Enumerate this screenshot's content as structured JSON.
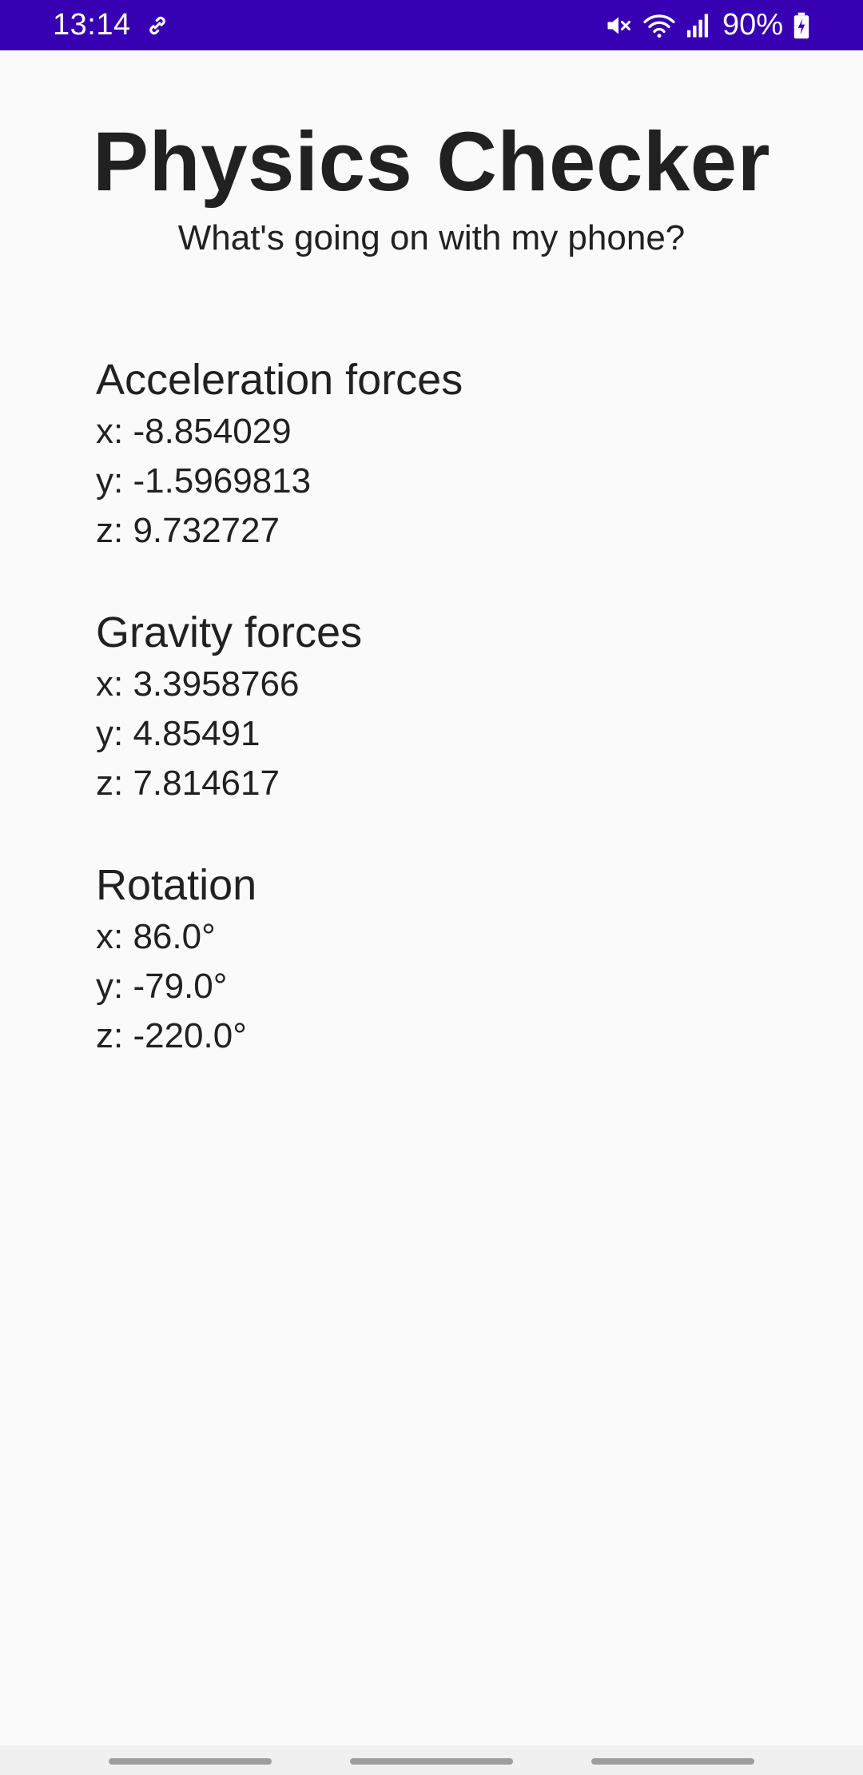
{
  "status_bar": {
    "time": "13:14",
    "battery": "90%",
    "icons": [
      "link-icon",
      "mute-icon",
      "wifi-icon",
      "signal-icon",
      "battery-charging-icon"
    ]
  },
  "app": {
    "title": "Physics Checker",
    "subtitle": "What's going on with my phone?"
  },
  "sections": {
    "acceleration": {
      "title": "Acceleration forces",
      "x": "x: -8.854029",
      "y": "y: -1.5969813",
      "z": "z: 9.732727"
    },
    "gravity": {
      "title": "Gravity forces",
      "x": "x: 3.3958766",
      "y": "y: 4.85491",
      "z": "z: 7.814617"
    },
    "rotation": {
      "title": "Rotation",
      "x": "x: 86.0°",
      "y": "y: -79.0°",
      "z": "z: -220.0°"
    }
  },
  "colors": {
    "status_bar": "#3700b3",
    "background": "#fafafa",
    "text": "#212121"
  }
}
